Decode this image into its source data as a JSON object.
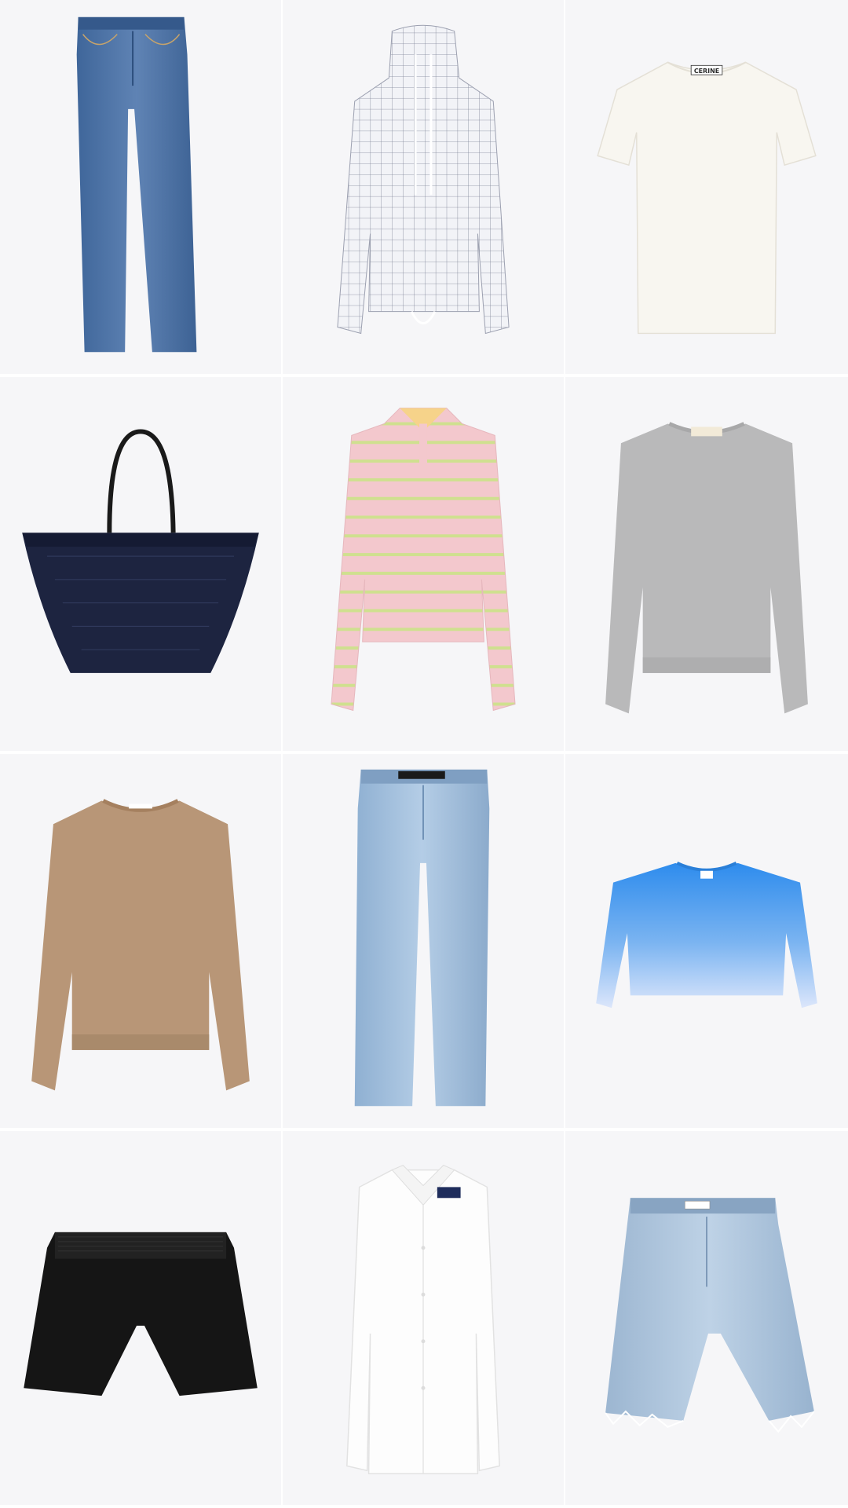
{
  "colors": {
    "tile_bg": "#f6f6f8",
    "divider": "#ffffff"
  },
  "grid": {
    "items": [
      {
        "name": "straight-leg-jeans",
        "icon": "jeans-icon",
        "color": "#4d72a3"
      },
      {
        "name": "grid-check-funnel-neck-top",
        "icon": "pullover-icon",
        "color": "#eceef4"
      },
      {
        "name": "white-tee",
        "icon": "tshirt-icon",
        "color": "#f7f5ef",
        "brand": "CERINE"
      },
      {
        "name": "navy-straw-tote",
        "icon": "tote-bag-icon",
        "color": "#1d2440"
      },
      {
        "name": "pink-striped-polo-sweater",
        "icon": "sweater-icon",
        "color": "#f2c9ce"
      },
      {
        "name": "grey-sweatshirt",
        "icon": "sweatshirt-icon",
        "color": "#b8b8b9"
      },
      {
        "name": "camel-sweatshirt",
        "icon": "sweatshirt-icon",
        "color": "#b89677"
      },
      {
        "name": "light-wash-jeans",
        "icon": "jeans-icon",
        "color": "#9bbad8"
      },
      {
        "name": "blue-ombre-sweatshirt",
        "icon": "sweatshirt-icon",
        "color": "#3d97ee"
      },
      {
        "name": "black-shorts",
        "icon": "shorts-icon",
        "color": "#141414"
      },
      {
        "name": "white-button-shirt",
        "icon": "shirt-icon",
        "color": "#fbfbfb"
      },
      {
        "name": "denim-cutoff-shorts",
        "icon": "denim-shorts-icon",
        "color": "#a7bfd6"
      }
    ]
  }
}
